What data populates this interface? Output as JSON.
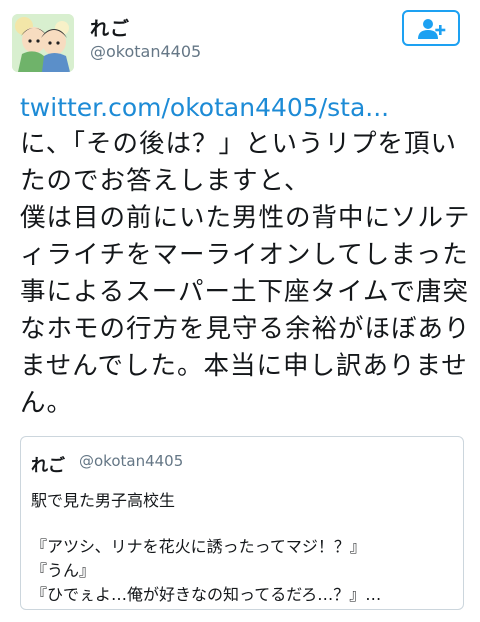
{
  "header": {
    "display_name": "れご",
    "handle": "@okotan4405",
    "follow_icon": "add-user-icon"
  },
  "tweet": {
    "link": "twitter.com/okotan4405/sta...",
    "lines": [
      "に、「その後は？」というリプを頂い",
      "たのでお答えしますと、",
      "僕は目の前にいた男性の背中にソルテ",
      "ィライチをマーライオンしてしまった",
      "事によるスーパー土下座タイムで唐突",
      "なホモの行方を見守る余裕がほぼあり",
      "ませんでした。本当に申し訳ありませ",
      "ん。"
    ]
  },
  "quote": {
    "display_name": "れご",
    "handle": "@okotan4405",
    "lines": [
      "駅で見た男子高校生",
      "『アツシ、リナを花火に誘ったってマジ！？』",
      "『うん』",
      "『ひでぇよ…俺が好きなの知ってるだろ…？』…"
    ]
  },
  "colors": {
    "link": "#1d8bd6",
    "accent": "#1da1f2",
    "muted": "#657786",
    "border": "#ccd6dd"
  }
}
